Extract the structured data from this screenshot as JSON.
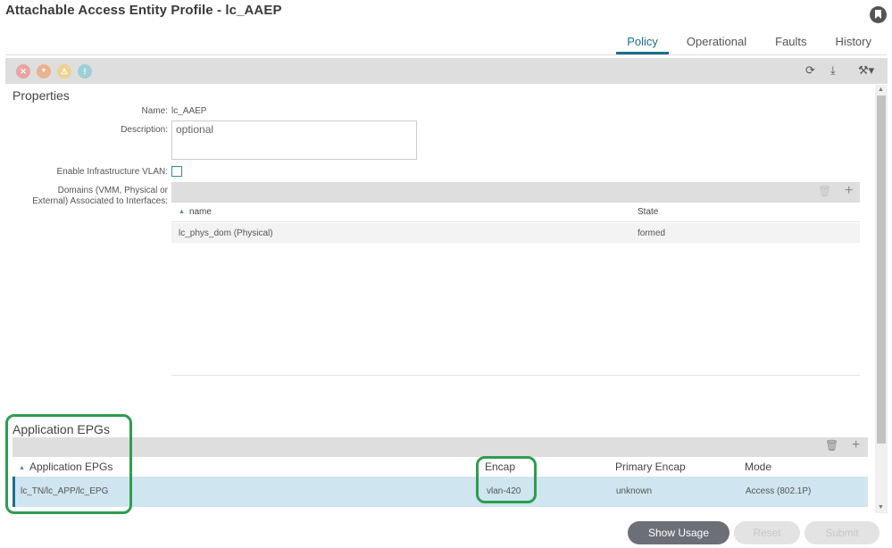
{
  "header": {
    "title": "Attachable Access Entity Profile - lc_AAEP",
    "bookmark_icon": "bookmark-icon"
  },
  "tabs": [
    {
      "label": "Policy",
      "active": true
    },
    {
      "label": "Operational",
      "active": false
    },
    {
      "label": "Faults",
      "active": false
    },
    {
      "label": "History",
      "active": false
    }
  ],
  "toolbar": {
    "fault_icons": [
      {
        "name": "critical-fault-icon",
        "glyph": "✕",
        "color": "#e8a4a4"
      },
      {
        "name": "major-fault-icon",
        "glyph": "▼",
        "color": "#eab38f"
      },
      {
        "name": "minor-fault-icon",
        "glyph": "⚠",
        "color": "#ecd38e"
      },
      {
        "name": "warning-fault-icon",
        "glyph": "!",
        "color": "#9fcfd8"
      }
    ],
    "refresh_icon": "⟳",
    "download_icon": "⤓",
    "tools_icon": "⚒▾"
  },
  "properties": {
    "section_title": "Properties",
    "name_label": "Name:",
    "name_value": "lc_AAEP",
    "description_label": "Description:",
    "description_placeholder": "optional",
    "infra_vlan_label": "Enable Infrastructure VLAN:",
    "infra_vlan_checked": false,
    "domains_label_line1": "Domains (VMM, Physical or",
    "domains_label_line2": "External) Associated to Interfaces:",
    "domains_table": {
      "columns": [
        "name",
        "State"
      ],
      "rows": [
        {
          "name": "lc_phys_dom (Physical)",
          "state": "formed"
        }
      ]
    }
  },
  "application_epgs": {
    "section_title": "Application EPGs",
    "columns": [
      "Application EPGs",
      "Encap",
      "Primary Encap",
      "Mode"
    ],
    "rows": [
      {
        "epg": "lc_TN/lc_APP/lc_EPG",
        "encap": "vlan-420",
        "primary_encap": "unknown",
        "mode": "Access (802.1P)"
      }
    ]
  },
  "icons": {
    "trash": "🗑",
    "plus": "+",
    "sort_up": "▲",
    "scroll_up": "▲",
    "scroll_down": "▼"
  },
  "footer": {
    "show_usage_label": "Show Usage",
    "reset_label": "Reset",
    "submit_label": "Submit"
  },
  "colors": {
    "accent": "#1d6f8c",
    "highlight": "#2e9d4f",
    "selected_row": "#cfe5ef"
  }
}
